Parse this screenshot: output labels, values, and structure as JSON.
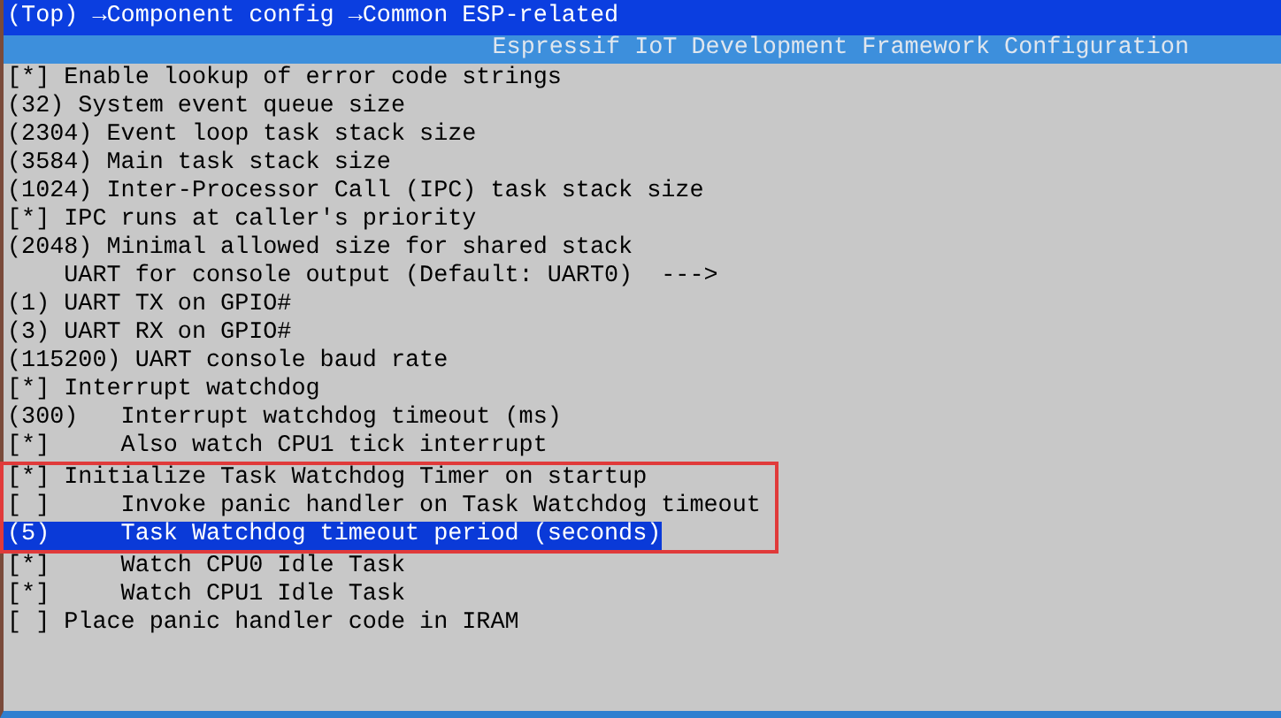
{
  "breadcrumb": "(Top) →Component config →Common ESP-related",
  "window": {
    "title": "Espressif IoT Development Framework Configuration"
  },
  "items": [
    {
      "text": "[*] Enable lookup of error code strings",
      "selected": false,
      "boxed": false
    },
    {
      "text": "(32) System event queue size",
      "selected": false,
      "boxed": false
    },
    {
      "text": "(2304) Event loop task stack size",
      "selected": false,
      "boxed": false
    },
    {
      "text": "(3584) Main task stack size",
      "selected": false,
      "boxed": false
    },
    {
      "text": "(1024) Inter-Processor Call (IPC) task stack size",
      "selected": false,
      "boxed": false
    },
    {
      "text": "[*] IPC runs at caller's priority",
      "selected": false,
      "boxed": false
    },
    {
      "text": "(2048) Minimal allowed size for shared stack",
      "selected": false,
      "boxed": false
    },
    {
      "text": "    UART for console output (Default: UART0)  --->",
      "selected": false,
      "boxed": false
    },
    {
      "text": "(1) UART TX on GPIO#",
      "selected": false,
      "boxed": false
    },
    {
      "text": "(3) UART RX on GPIO#",
      "selected": false,
      "boxed": false
    },
    {
      "text": "(115200) UART console baud rate",
      "selected": false,
      "boxed": false
    },
    {
      "text": "[*] Interrupt watchdog",
      "selected": false,
      "boxed": false
    },
    {
      "text": "(300)   Interrupt watchdog timeout (ms)",
      "selected": false,
      "boxed": false
    },
    {
      "text": "[*]     Also watch CPU1 tick interrupt",
      "selected": false,
      "boxed": false
    },
    {
      "text": "[*] Initialize Task Watchdog Timer on startup",
      "selected": false,
      "boxed": true
    },
    {
      "text": "[ ]     Invoke panic handler on Task Watchdog timeout",
      "selected": false,
      "boxed": true
    },
    {
      "text": "(5)     Task Watchdog timeout period (seconds)",
      "selected": true,
      "boxed": true
    },
    {
      "text": "[*]     Watch CPU0 Idle Task",
      "selected": false,
      "boxed": false
    },
    {
      "text": "[*]     Watch CPU1 Idle Task",
      "selected": false,
      "boxed": false
    },
    {
      "text": "[ ] Place panic handler code in IRAM",
      "selected": false,
      "boxed": false
    }
  ]
}
